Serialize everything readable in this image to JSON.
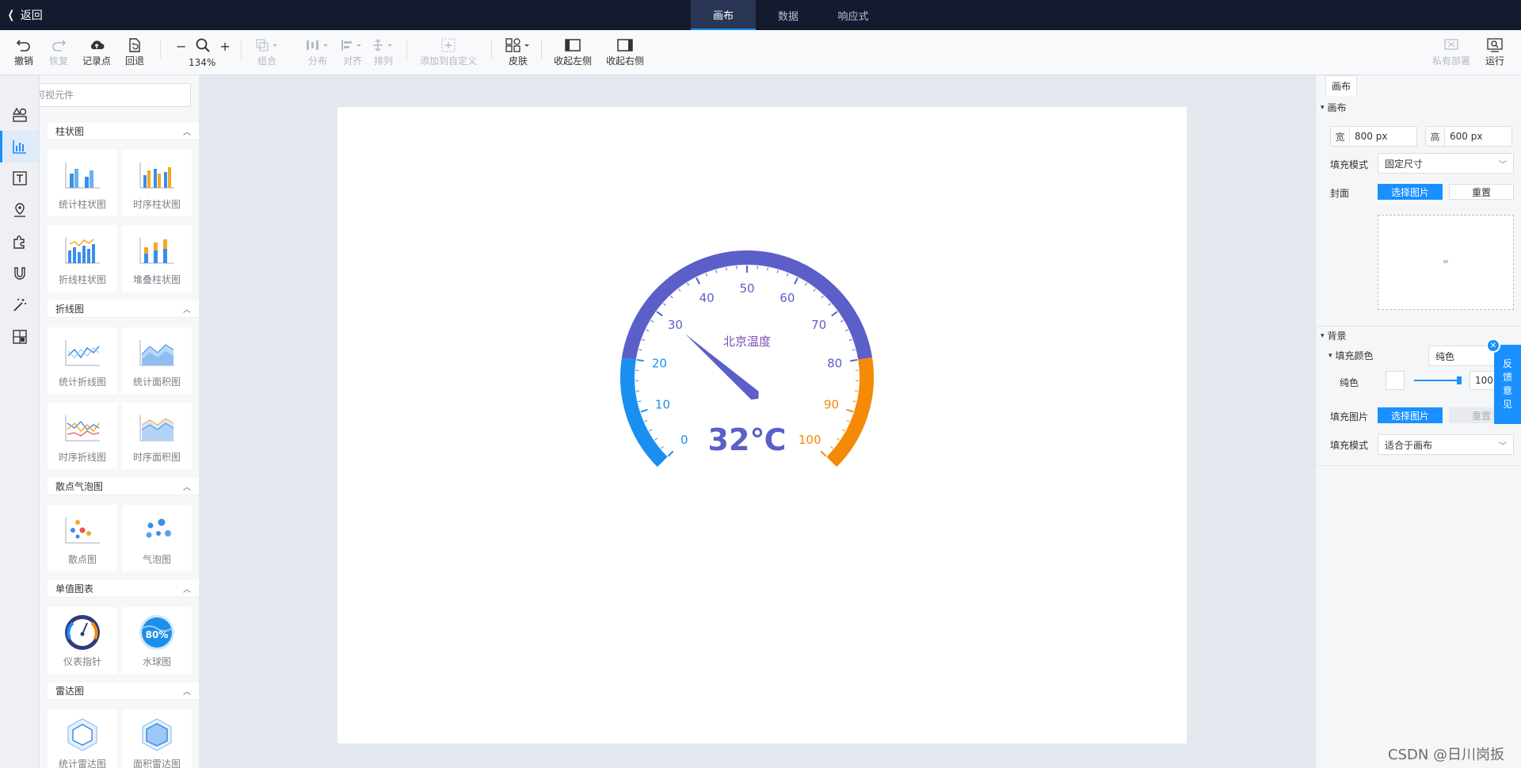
{
  "topbar": {
    "back_label": "返回",
    "tabs": [
      {
        "label": "画布",
        "active": true
      },
      {
        "label": "数据",
        "active": false
      },
      {
        "label": "响应式",
        "active": false
      }
    ]
  },
  "toolbar": {
    "undo": "撤销",
    "redo": "恢复",
    "checkpoint": "记录点",
    "rollback": "回退",
    "zoom": "134%",
    "group": "组合",
    "distribute": "分布",
    "align": "对齐",
    "arrange": "排列",
    "add_custom": "添加到自定义",
    "skin": "皮肤",
    "collapse_left": "收起左侧",
    "collapse_right": "收起右侧",
    "private_deploy": "私有部署",
    "run": "运行"
  },
  "left_panel": {
    "search_placeholder": "搜索可视元件",
    "sections": [
      {
        "title": "柱状图",
        "items": [
          "统计柱状图",
          "时序柱状图",
          "折线柱状图",
          "堆叠柱状图"
        ]
      },
      {
        "title": "折线图",
        "items": [
          "统计折线图",
          "统计面积图",
          "时序折线图",
          "时序面积图"
        ]
      },
      {
        "title": "散点气泡图",
        "items": [
          "散点图",
          "气泡图"
        ]
      },
      {
        "title": "单值图表",
        "items": [
          "仪表指针",
          "水球图"
        ]
      },
      {
        "title": "雷达图",
        "items": [
          "统计雷达图",
          "面积雷达图"
        ]
      }
    ],
    "water_ball_value": "80%"
  },
  "gauge": {
    "title": "北京温度",
    "value": 32,
    "value_text": "32℃",
    "min": 0,
    "max": 100,
    "ticks": [
      "0",
      "10",
      "20",
      "30",
      "40",
      "50",
      "60",
      "70",
      "80",
      "90",
      "100"
    ],
    "colors": {
      "low": "#1a8ff0",
      "mid": "#5b5fc7",
      "high": "#f48a06",
      "title": "#7b4fb5"
    },
    "bands": [
      {
        "to": 20,
        "color": "#1a8ff0"
      },
      {
        "to": 80,
        "color": "#5b5fc7"
      },
      {
        "to": 100,
        "color": "#f48a06"
      }
    ]
  },
  "right_panel": {
    "tab": "画布",
    "canvas_section": "画布",
    "width_label": "宽",
    "width_value": "800 px",
    "height_label": "高",
    "height_value": "600 px",
    "fill_mode_label": "填充模式",
    "fill_mode_value": "固定尺寸",
    "cover_label": "封面",
    "select_image": "选择图片",
    "reset": "重置",
    "background_section": "背景",
    "fill_color_label": "填充颜色",
    "fill_color_value": "纯色",
    "solid_label": "纯色",
    "opacity_value": "100",
    "fill_image_label": "填充图片",
    "select_image2": "选择图片",
    "reset2": "重置",
    "fill_mode2_label": "填充模式",
    "fill_mode2_value": "适合于画布"
  },
  "feedback": {
    "label": [
      "反",
      "馈",
      "意",
      "见"
    ]
  },
  "watermark": "CSDN @日川岗扳"
}
